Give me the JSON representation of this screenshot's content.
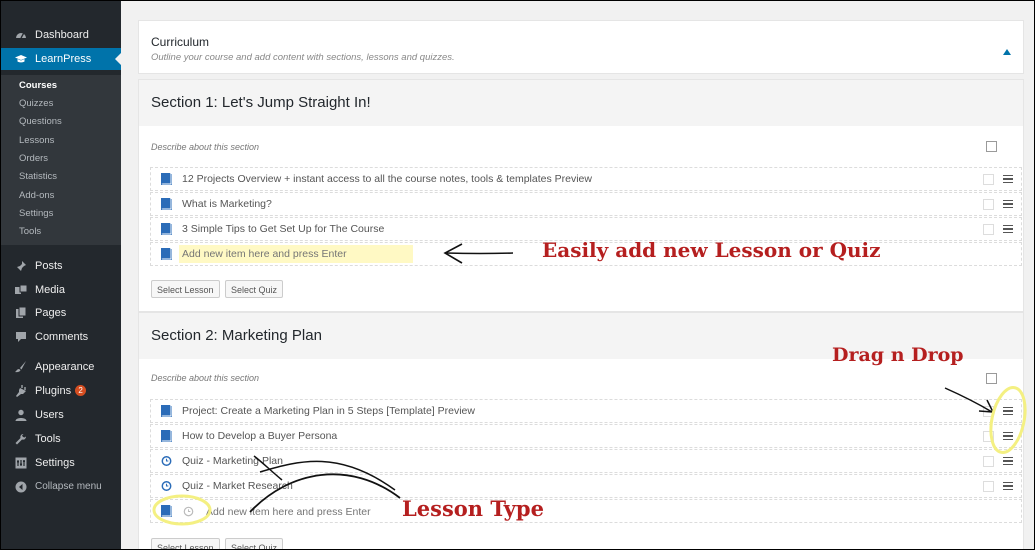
{
  "sidebar": {
    "top_items": [
      {
        "label": "Dashboard",
        "icon": "dashboard-icon"
      },
      {
        "label": "LearnPress",
        "icon": "graduation-cap-icon"
      }
    ],
    "submenu": [
      "Courses",
      "Quizzes",
      "Questions",
      "Lessons",
      "Orders",
      "Statistics",
      "Add-ons",
      "Settings",
      "Tools"
    ],
    "items": [
      {
        "label": "Posts",
        "icon": "pin-icon"
      },
      {
        "label": "Media",
        "icon": "media-icon"
      },
      {
        "label": "Pages",
        "icon": "pages-icon"
      },
      {
        "label": "Comments",
        "icon": "comment-icon"
      },
      {
        "label": "Appearance",
        "icon": "brush-icon"
      },
      {
        "label": "Plugins",
        "icon": "plugin-icon",
        "badge": "2"
      },
      {
        "label": "Users",
        "icon": "users-icon"
      },
      {
        "label": "Tools",
        "icon": "wrench-icon"
      },
      {
        "label": "Settings",
        "icon": "settings-icon"
      },
      {
        "label": "Collapse menu",
        "icon": "collapse-icon"
      }
    ]
  },
  "curriculum": {
    "title": "Curriculum",
    "subtitle": "Outline your course and add content with sections, lessons and quizzes."
  },
  "sections": [
    {
      "title": "Section 1: Let's Jump Straight In!",
      "describe_placeholder": "Describe about this section",
      "items": [
        {
          "type": "lesson",
          "title": "12 Projects Overview + instant access to all the course notes, tools & templates Preview"
        },
        {
          "type": "lesson",
          "title": "What is Marketing?"
        },
        {
          "type": "lesson",
          "title": "3 Simple Tips to Get Set Up for The Course"
        }
      ],
      "add_placeholder": "Add new item here and press Enter",
      "buttons": {
        "select_lesson": "Select Lesson",
        "select_quiz": "Select Quiz"
      }
    },
    {
      "title": "Section 2: Marketing Plan",
      "describe_placeholder": "Describe about this section",
      "items": [
        {
          "type": "lesson",
          "title": "Project: Create a Marketing Plan in 5 Steps [Template] Preview"
        },
        {
          "type": "lesson",
          "title": "How to Develop a Buyer Persona"
        },
        {
          "type": "quiz",
          "title": "Quiz - Marketing Plan"
        },
        {
          "type": "quiz",
          "title": "Quiz - Market Research"
        }
      ],
      "add_placeholder": "Add new item here and press Enter",
      "buttons": {
        "select_lesson": "Select Lesson",
        "select_quiz": "Select Quiz"
      }
    }
  ],
  "annotations": {
    "add_item": "Easily add new Lesson or Quiz",
    "drag_drop": "Drag n Drop",
    "lesson_type": "Lesson Type"
  },
  "colors": {
    "sidebar_bg": "#23282d",
    "active_menu": "#0073aa",
    "annotation_red": "#b51f1f",
    "highlight_yellow": "#f4f082",
    "lesson_icon": "#2b6cb8"
  }
}
